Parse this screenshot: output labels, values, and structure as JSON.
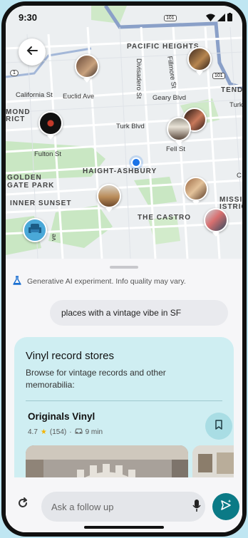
{
  "status_bar": {
    "time": "9:30"
  },
  "map": {
    "route_badge": "101",
    "route_badge_2": "101",
    "route_badge_3": "1",
    "neighborhoods": {
      "pacific_heights": "PACIFIC HEIGHTS",
      "haight_ashbury": "HAIGHT-ASHBURY",
      "golden_gate_park": "GOLDEN\nGATE PARK",
      "inner_sunset": "INNER SUNSET",
      "the_castro": "THE CASTRO",
      "mission": "MISSIO\nISTRIC",
      "richmond": "MOND\nRICT",
      "tenderloin": "TENDE"
    },
    "streets": {
      "california": "California St",
      "euclid": "Euclid Ave",
      "divisadero": "Divisadero St",
      "fillmore": "Fillmore St",
      "geary": "Geary Blvd",
      "turk_blvd": "Turk Blvd",
      "turk_st": "Turk",
      "fulton": "Fulton St",
      "fell": "Fell St",
      "cut": "ve",
      "c_label": "C"
    }
  },
  "sheet": {
    "ai_note": "Generative AI experiment. Info quality may vary.",
    "query": "places with a vintage vibe in SF",
    "card": {
      "title": "Vinyl record stores",
      "description": "Browse for vintage records and other memorabilia:",
      "place": {
        "name": "Originals Vinyl",
        "rating": "4.7",
        "reviews": "(154)",
        "drive_time": "9 min"
      }
    }
  },
  "bottom_bar": {
    "placeholder": "Ask a follow up"
  },
  "colors": {
    "accent": "#0b7a86",
    "card_bg": "#cfeef2",
    "location_dot": "#1a73e8"
  }
}
